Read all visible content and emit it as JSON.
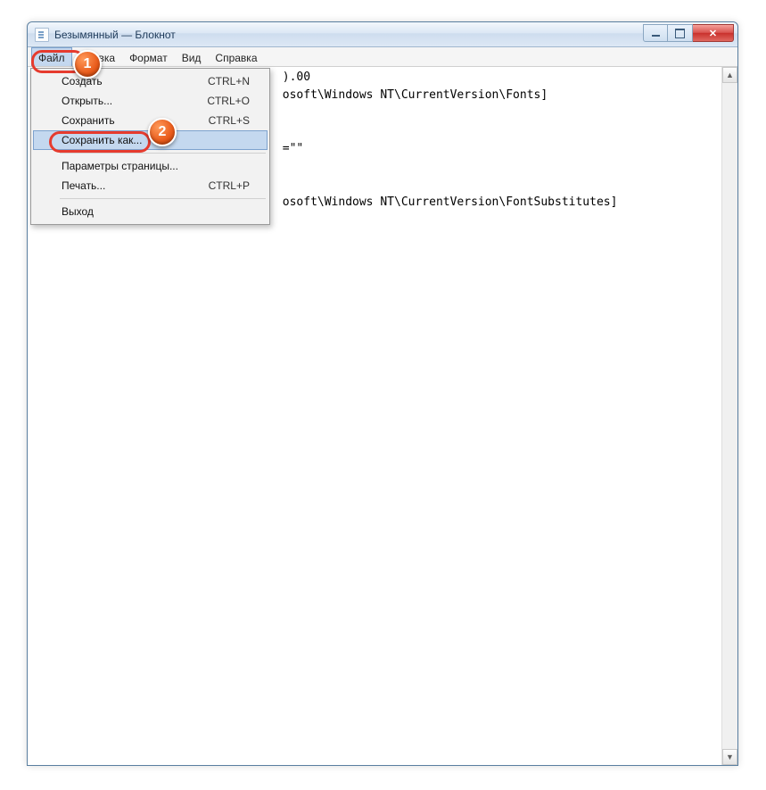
{
  "window": {
    "title": "Безымянный — Блокнот"
  },
  "menubar": {
    "items": [
      {
        "label": "Файл",
        "active": true
      },
      {
        "label": "Правка"
      },
      {
        "label": "Формат"
      },
      {
        "label": "Вид"
      },
      {
        "label": "Справка"
      }
    ]
  },
  "dropdown": {
    "items": [
      {
        "label": "Создать",
        "shortcut": "CTRL+N"
      },
      {
        "label": "Открыть...",
        "shortcut": "CTRL+O"
      },
      {
        "label": "Сохранить",
        "shortcut": "CTRL+S"
      },
      {
        "label": "Сохранить как...",
        "shortcut": "",
        "hover": true
      },
      {
        "sep": true
      },
      {
        "label": "Параметры страницы...",
        "shortcut": ""
      },
      {
        "label": "Печать...",
        "shortcut": "CTRL+P"
      },
      {
        "sep": true
      },
      {
        "label": "Выход",
        "shortcut": ""
      }
    ]
  },
  "editor": {
    "lines": [
      "                                    ).00",
      "                                    osoft\\Windows NT\\CurrentVersion\\Fonts]",
      "",
      "",
      "                                    =\"\"",
      "",
      "",
      "                                    osoft\\Windows NT\\CurrentVersion\\FontSubstitutes]"
    ]
  },
  "markers": {
    "one": "1",
    "two": "2"
  }
}
